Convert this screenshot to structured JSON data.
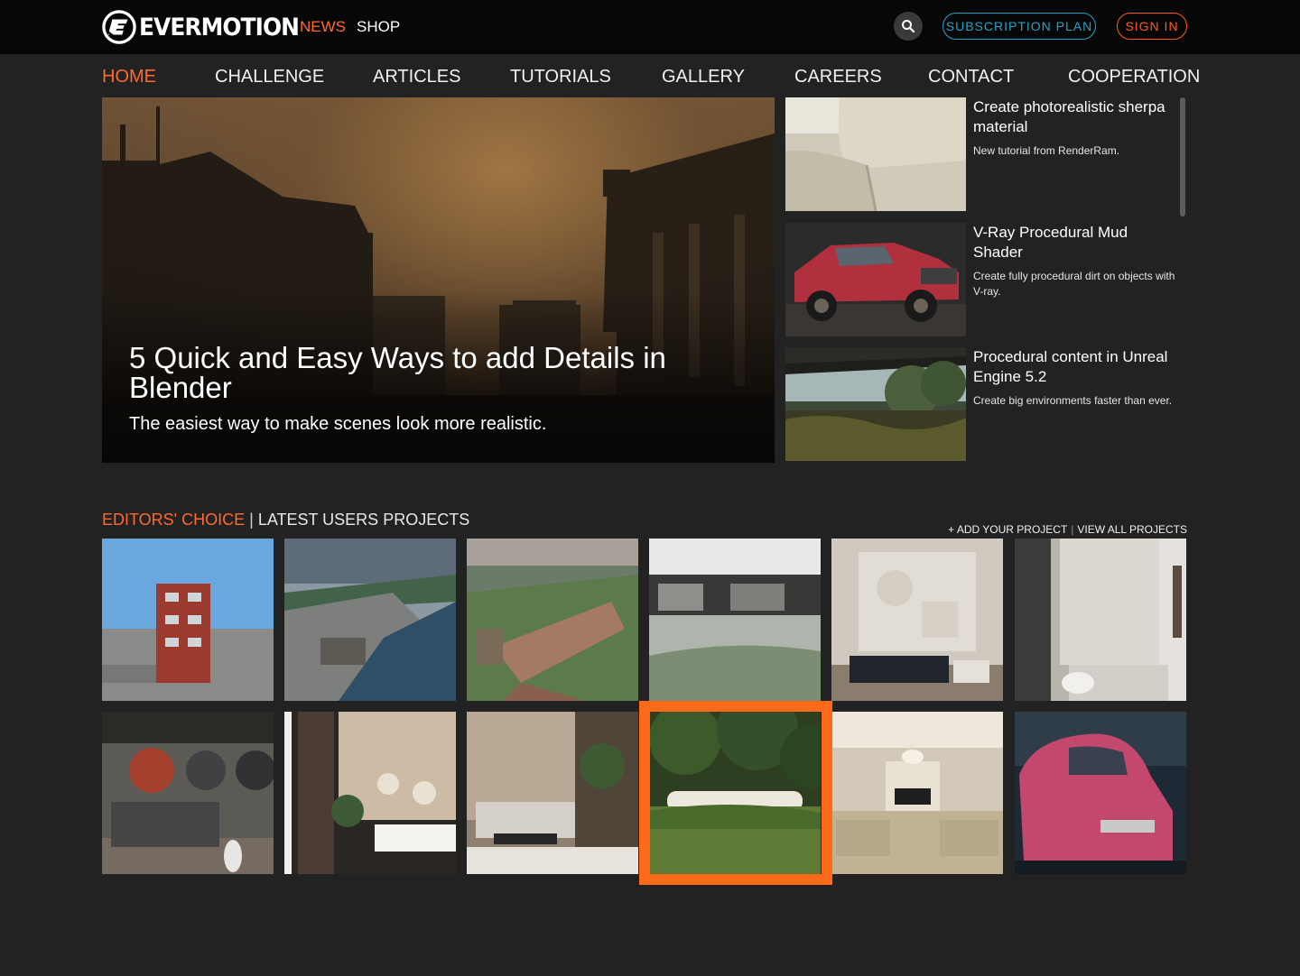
{
  "brand": {
    "name": "EVERMOTION"
  },
  "topnav": {
    "news": "NEWS",
    "shop": "SHOP",
    "subscription": "SUBSCRIPTION PLAN",
    "sign_in": "SIGN IN"
  },
  "icons": {
    "search": "search-icon",
    "logo": "evermotion-logo-icon"
  },
  "colors": {
    "accent": "#ff6a2e",
    "subscription": "#26a3c9",
    "background": "#222222",
    "topbar": "#070707"
  },
  "mainnav": [
    "HOME",
    "CHALLENGE",
    "ARTICLES",
    "TUTORIALS",
    "GALLERY",
    "CAREERS",
    "CONTACT",
    "COOPERATION"
  ],
  "hero": {
    "title": "5 Quick and Easy Ways to add Details in Blender",
    "subtitle": "The easiest way to make scenes look more realistic."
  },
  "articles": [
    {
      "title": "Create photorealistic sherpa material",
      "desc": "New tutorial from RenderRam."
    },
    {
      "title": "V-Ray Procedural Mud Shader",
      "desc": "Create fully procedural dirt on objects with V-ray."
    },
    {
      "title": "Procedural content in Unreal Engine 5.2",
      "desc": "Create big environments faster than ever."
    }
  ],
  "section": {
    "editors_choice": "EDITORS' CHOICE",
    "separator": "|",
    "latest": "LATEST USERS PROJECTS",
    "add_project": "+ ADD YOUR PROJECT",
    "view_all": "VIEW ALL PROJECTS"
  }
}
